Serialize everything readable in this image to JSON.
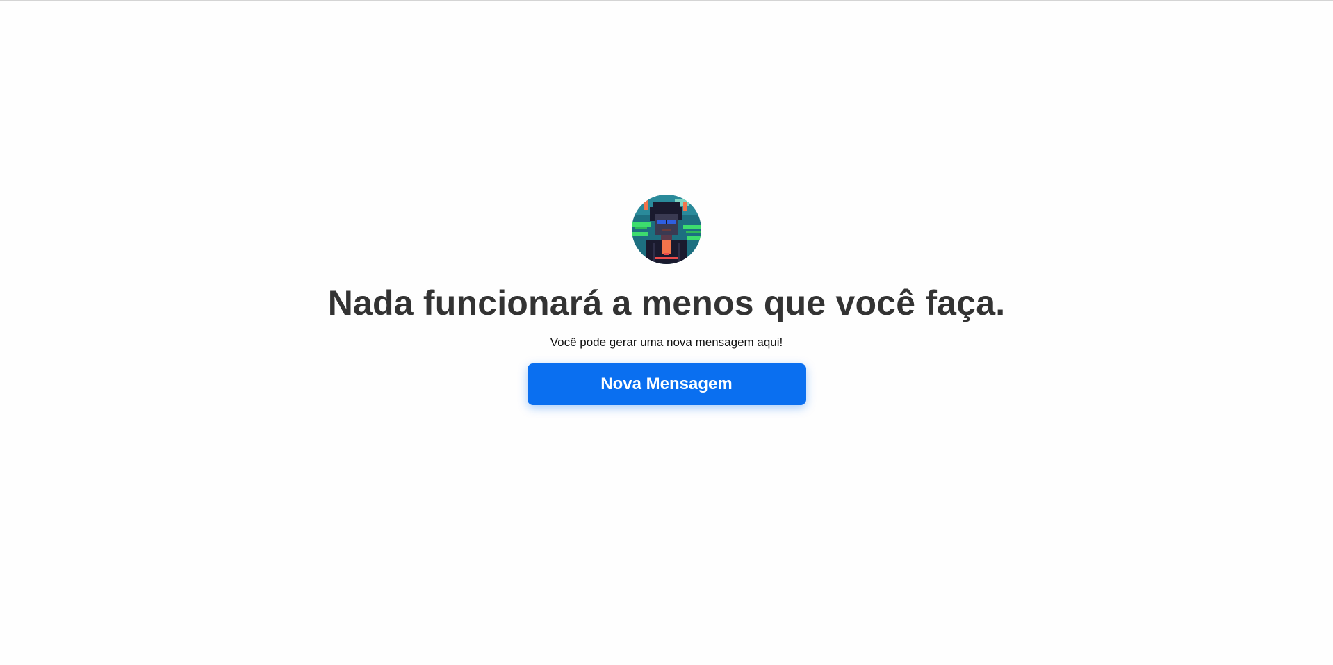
{
  "avatar": {
    "icon": "pixel-art-person-avatar",
    "colors": {
      "background": "#1d6f80",
      "accent_green": "#3ddc6e",
      "accent_orange": "#f2744b",
      "glasses": "#2f5fe0",
      "hair": "#1a1a2e"
    }
  },
  "main": {
    "headline": "Nada funcionará a menos que você faça.",
    "subtext": "Você pode gerar uma nova mensagem aqui!",
    "button_label": "Nova Mensagem"
  },
  "colors": {
    "background": "#fefefe",
    "headline_text": "#333333",
    "button_bg": "#0a6ff0",
    "button_text": "#ffffff"
  }
}
